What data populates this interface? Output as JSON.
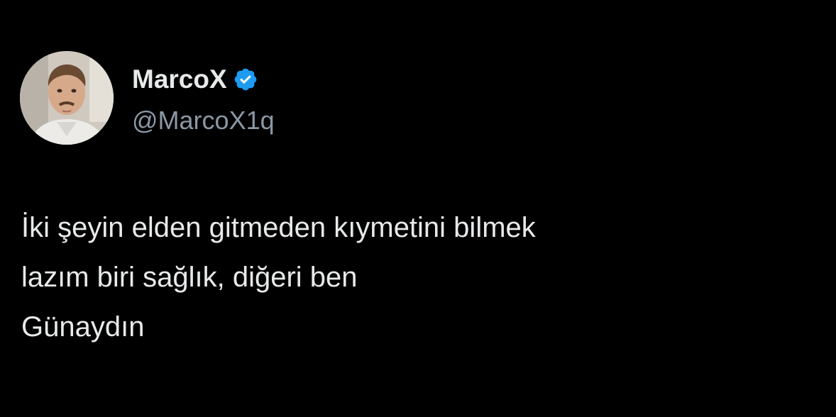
{
  "author": {
    "display_name": "MarcoX",
    "handle": "@MarcoX1q",
    "verified": true,
    "verified_icon": "verified-badge-icon",
    "avatar_icon": "profile-photo"
  },
  "tweet": {
    "lines": [
      "İki şeyin elden gitmeden kıymetini bilmek",
      "lazım biri sağlık, diğeri ben",
      "Günaydın"
    ]
  },
  "colors": {
    "background": "#000000",
    "text": "#e7e9ea",
    "handle": "#8b98a5",
    "verified": "#1d9bf0"
  }
}
